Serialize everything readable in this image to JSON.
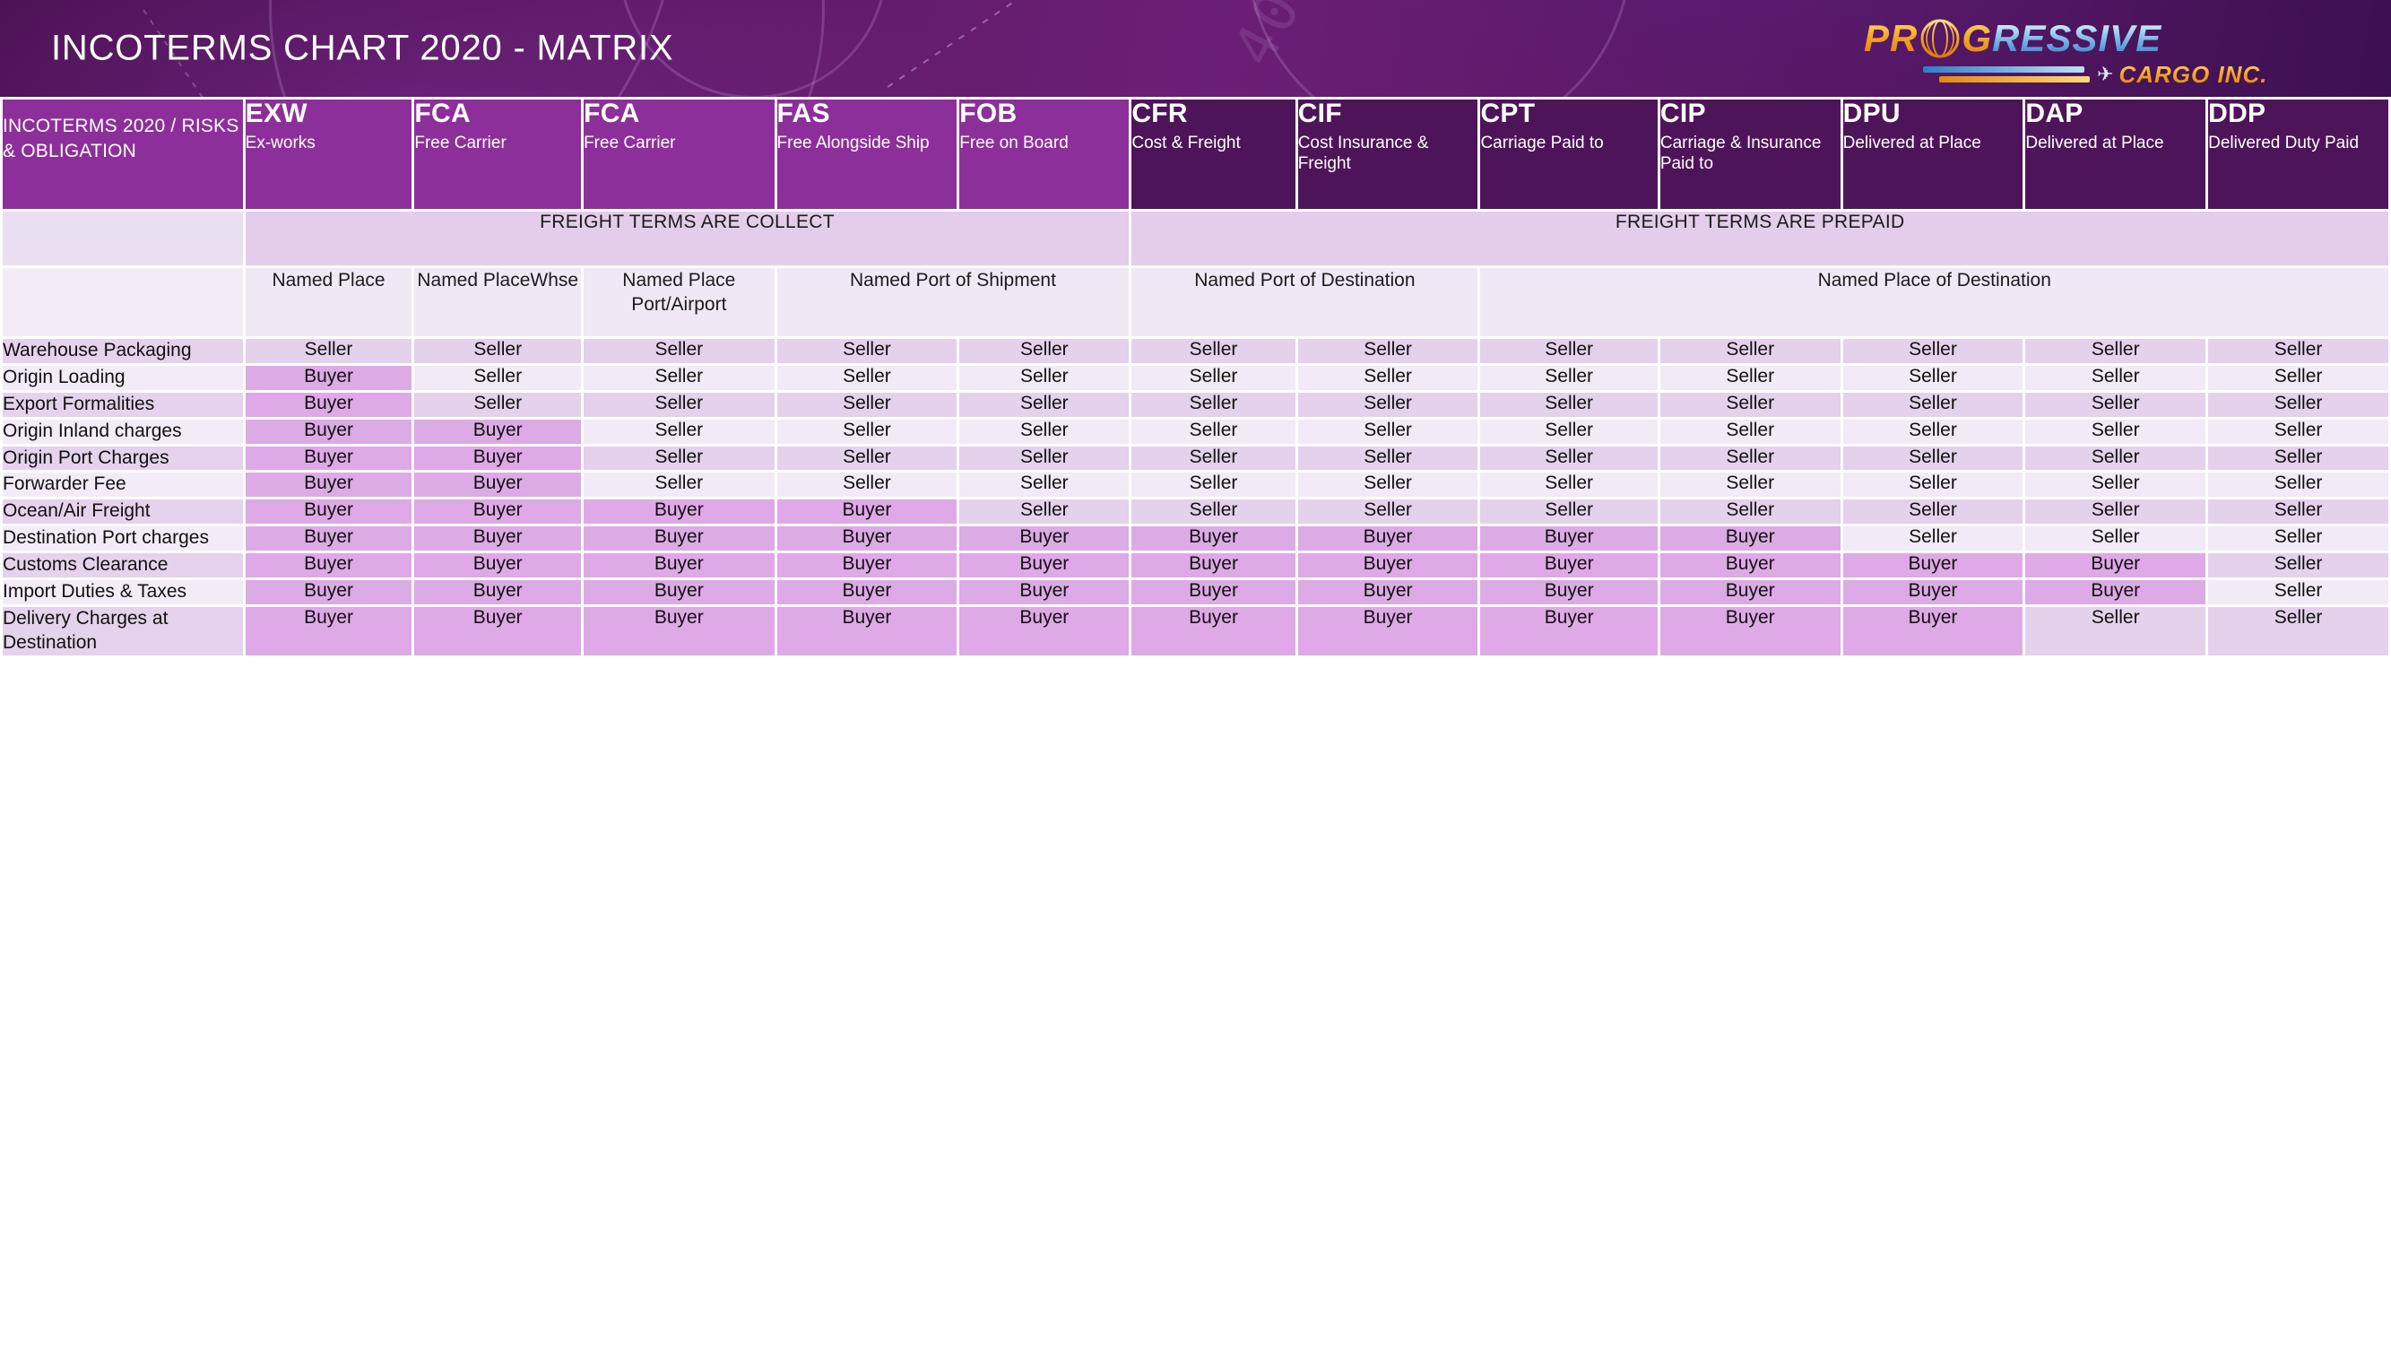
{
  "banner": {
    "title": "INCOTERMS CHART 2020 - MATRIX",
    "accent_dark": "#4e1459",
    "accent_light": "#8d2f9a"
  },
  "logo": {
    "pr": "PR",
    "globe_icon": "globe-icon",
    "rest_g": "G",
    "rest": "RESSIVE",
    "plane_icon": "airplane-icon",
    "cargo": "CARGO INC."
  },
  "table": {
    "corner_label": "INCOTERMS 2020 / RISKS & OBLIGATION",
    "columns": [
      {
        "code": "EXW",
        "desc": "Ex-works",
        "dark": false
      },
      {
        "code": "FCA",
        "desc": "Free Carrier",
        "dark": false
      },
      {
        "code": "FCA",
        "desc": "Free Carrier",
        "dark": false
      },
      {
        "code": "FAS",
        "desc": "Free Alongside Ship",
        "dark": false
      },
      {
        "code": "FOB",
        "desc": "Free on Board",
        "dark": false
      },
      {
        "code": "CFR",
        "desc": "Cost & Freight",
        "dark": true
      },
      {
        "code": "CIF",
        "desc": "Cost Insurance & Freight",
        "dark": true
      },
      {
        "code": "CPT",
        "desc": "Carriage Paid to",
        "dark": true
      },
      {
        "code": "CIP",
        "desc": "Carriage & Insurance Paid to",
        "dark": true
      },
      {
        "code": "DPU",
        "desc": "Delivered at Place",
        "dark": true
      },
      {
        "code": "DAP",
        "desc": "Delivered at Place",
        "dark": true
      },
      {
        "code": "DDP",
        "desc": "Delivered Duty Paid",
        "dark": true
      }
    ],
    "freight_bands": [
      {
        "label": "FREIGHT TERMS ARE COLLECT",
        "span": 5
      },
      {
        "label": "FREIGHT TERMS ARE PREPAID",
        "span": 7
      }
    ],
    "named_places": [
      {
        "label": "Named Place",
        "span": 1
      },
      {
        "label": "Named PlaceWhse",
        "span": 1
      },
      {
        "label": "Named Place Port/Airport",
        "span": 1
      },
      {
        "label": "Named Port of Shipment",
        "span": 2
      },
      {
        "label": "Named Port of Destination",
        "span": 2
      },
      {
        "label": "Named Place of Destination",
        "span": 5
      }
    ],
    "seller_label": "Seller",
    "buyer_label": "Buyer",
    "rows": [
      {
        "label": "Warehouse Packaging",
        "values": [
          "Seller",
          "Seller",
          "Seller",
          "Seller",
          "Seller",
          "Seller",
          "Seller",
          "Seller",
          "Seller",
          "Seller",
          "Seller",
          "Seller"
        ]
      },
      {
        "label": "Origin Loading",
        "values": [
          "Buyer",
          "Seller",
          "Seller",
          "Seller",
          "Seller",
          "Seller",
          "Seller",
          "Seller",
          "Seller",
          "Seller",
          "Seller",
          "Seller"
        ]
      },
      {
        "label": "Export Formalities",
        "values": [
          "Buyer",
          "Seller",
          "Seller",
          "Seller",
          "Seller",
          "Seller",
          "Seller",
          "Seller",
          "Seller",
          "Seller",
          "Seller",
          "Seller"
        ]
      },
      {
        "label": "Origin Inland charges",
        "values": [
          "Buyer",
          "Buyer",
          "Seller",
          "Seller",
          "Seller",
          "Seller",
          "Seller",
          "Seller",
          "Seller",
          "Seller",
          "Seller",
          "Seller"
        ]
      },
      {
        "label": "Origin Port Charges",
        "values": [
          "Buyer",
          "Buyer",
          "Seller",
          "Seller",
          "Seller",
          "Seller",
          "Seller",
          "Seller",
          "Seller",
          "Seller",
          "Seller",
          "Seller"
        ]
      },
      {
        "label": "Forwarder Fee",
        "values": [
          "Buyer",
          "Buyer",
          "Seller",
          "Seller",
          "Seller",
          "Seller",
          "Seller",
          "Seller",
          "Seller",
          "Seller",
          "Seller",
          "Seller"
        ]
      },
      {
        "label": "Ocean/Air Freight",
        "values": [
          "Buyer",
          "Buyer",
          "Buyer",
          "Buyer",
          "Seller",
          "Seller",
          "Seller",
          "Seller",
          "Seller",
          "Seller",
          "Seller",
          "Seller"
        ]
      },
      {
        "label": "Destination Port charges",
        "values": [
          "Buyer",
          "Buyer",
          "Buyer",
          "Buyer",
          "Buyer",
          "Buyer",
          "Buyer",
          "Buyer",
          "Buyer",
          "Seller",
          "Seller",
          "Seller"
        ]
      },
      {
        "label": "Customs Clearance",
        "values": [
          "Buyer",
          "Buyer",
          "Buyer",
          "Buyer",
          "Buyer",
          "Buyer",
          "Buyer",
          "Buyer",
          "Buyer",
          "Buyer",
          "Buyer",
          "Seller"
        ]
      },
      {
        "label": "Import Duties & Taxes",
        "values": [
          "Buyer",
          "Buyer",
          "Buyer",
          "Buyer",
          "Buyer",
          "Buyer",
          "Buyer",
          "Buyer",
          "Buyer",
          "Buyer",
          "Buyer",
          "Seller"
        ]
      },
      {
        "label": "Delivery Charges at Destination",
        "values": [
          "Buyer",
          "Buyer",
          "Buyer",
          "Buyer",
          "Buyer",
          "Buyer",
          "Buyer",
          "Buyer",
          "Buyer",
          "Buyer",
          "Seller",
          "Seller"
        ]
      }
    ]
  }
}
